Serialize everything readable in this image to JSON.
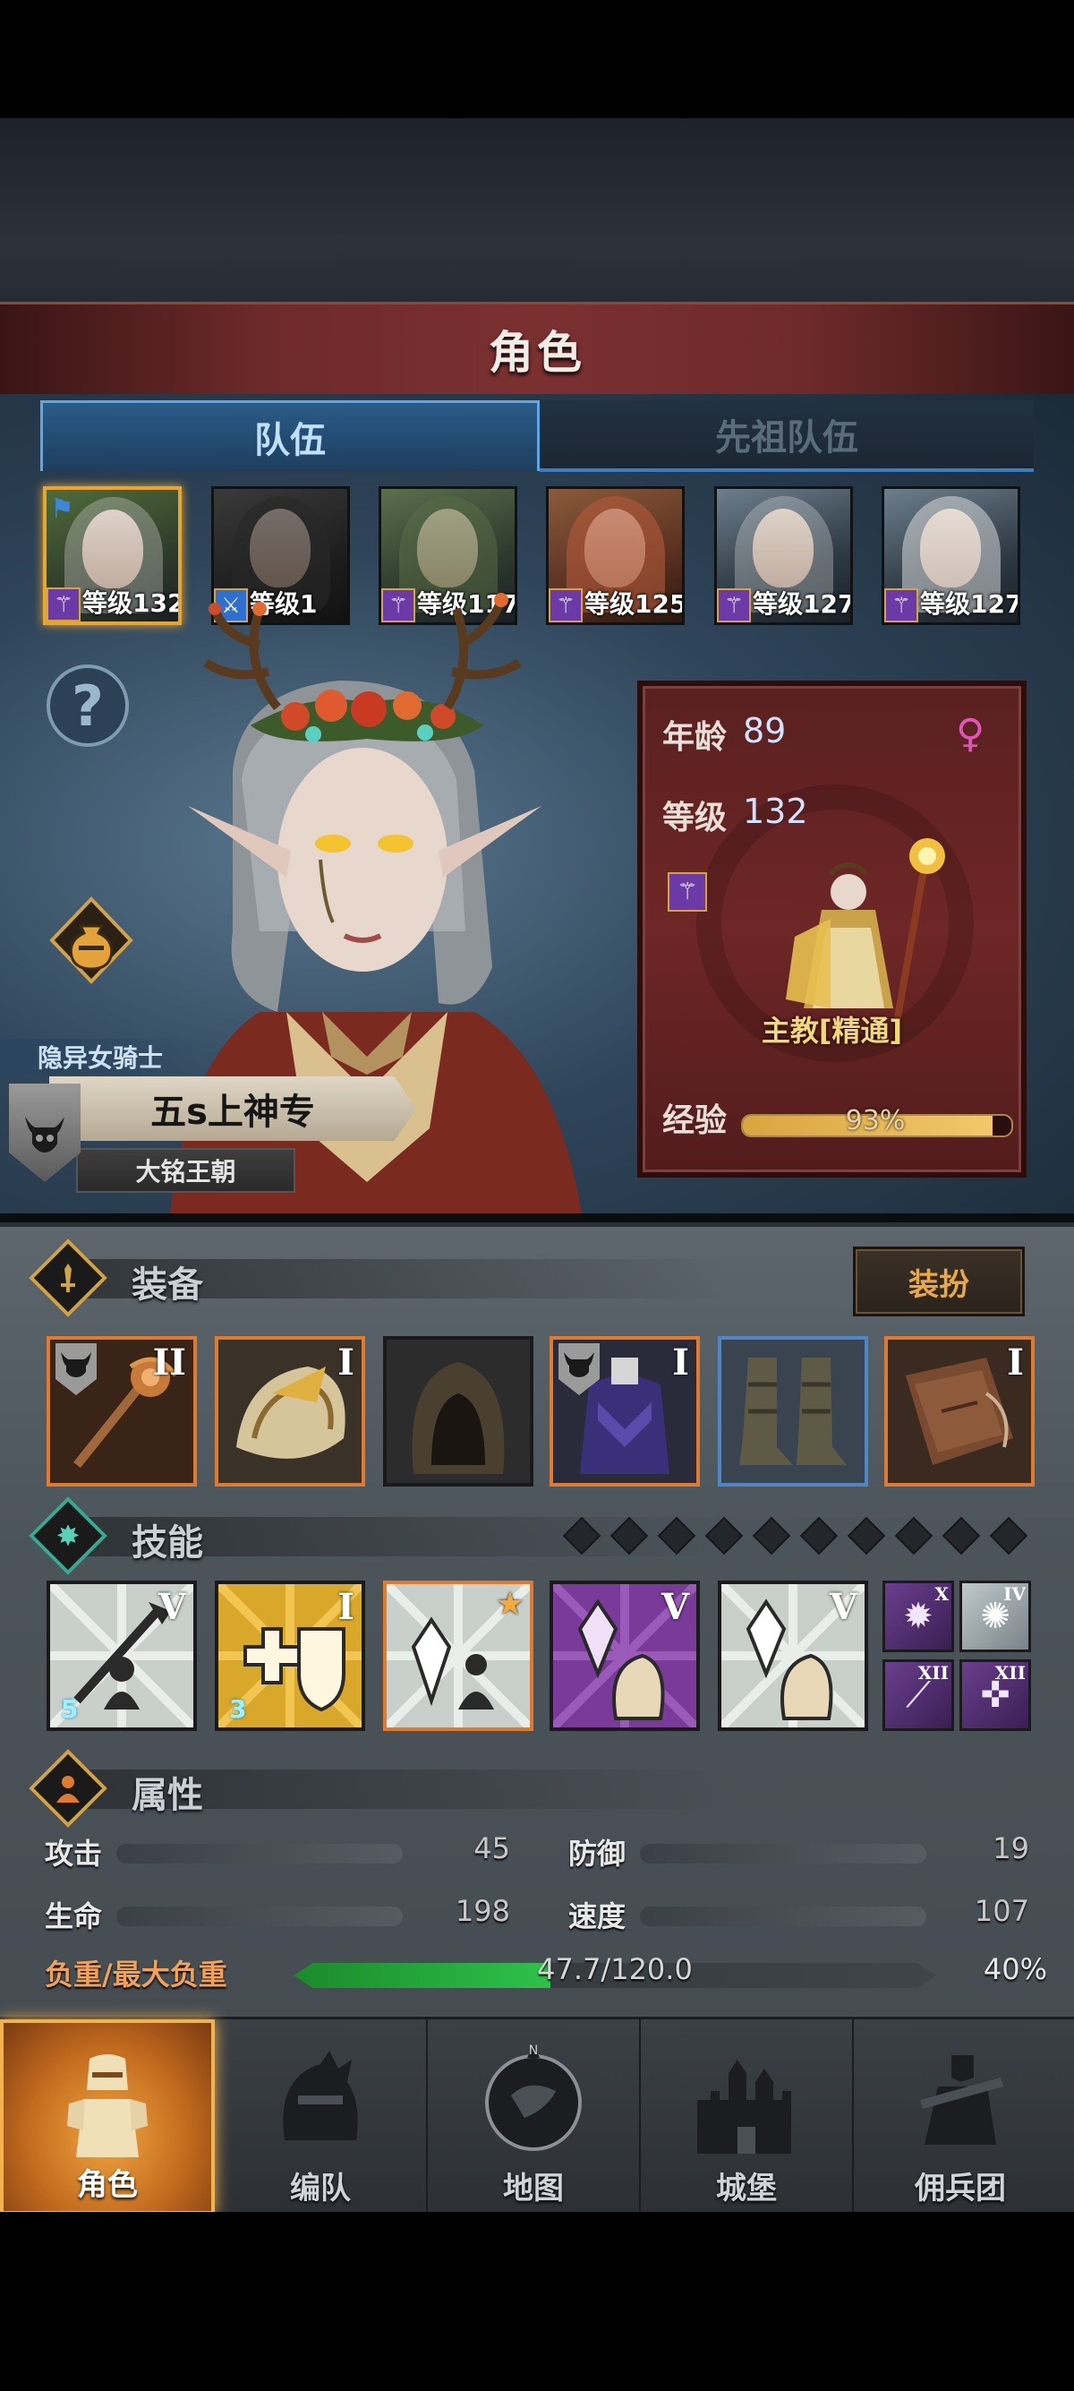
{
  "header": {
    "title": "角色"
  },
  "tabs": [
    {
      "label": "队伍",
      "active": true
    },
    {
      "label": "先祖队伍",
      "active": false
    }
  ],
  "party": [
    {
      "level_text": "等级132",
      "selected": true
    },
    {
      "level_text": "等级1",
      "selected": false
    },
    {
      "level_text": "等级117",
      "selected": false
    },
    {
      "level_text": "等级125",
      "selected": false
    },
    {
      "level_text": "等级127",
      "selected": false
    },
    {
      "level_text": "等级127",
      "selected": false
    }
  ],
  "character": {
    "class_title": "隐异女骑士",
    "name": "五s上神专",
    "dynasty": "大铭王朝"
  },
  "stat_card": {
    "age_label": "年龄",
    "age_value": "89",
    "level_label": "等级",
    "level_value": "132",
    "class_name": "主教[精通]",
    "exp_label": "经验",
    "exp_percent_text": "93%",
    "exp_fraction": 0.93,
    "gender_icon": "female-symbol"
  },
  "equipment": {
    "title": "装备",
    "outfit_label": "装扮",
    "slots": [
      {
        "name": "staff",
        "roman": "II",
        "rarity": "orange",
        "crest": true
      },
      {
        "name": "pauldron",
        "roman": "I",
        "rarity": "orange",
        "crest": false
      },
      {
        "name": "hood",
        "roman": "",
        "rarity": "none",
        "crest": false
      },
      {
        "name": "armor",
        "roman": "I",
        "rarity": "orange",
        "crest": true
      },
      {
        "name": "boots",
        "roman": "",
        "rarity": "blue",
        "crest": false
      },
      {
        "name": "book",
        "roman": "I",
        "rarity": "orange",
        "crest": false
      }
    ]
  },
  "skills": {
    "title": "技能",
    "dot_count": 10,
    "slots": [
      {
        "roman": "V",
        "count": "5",
        "star": false
      },
      {
        "roman": "I",
        "count": "3",
        "star": false
      },
      {
        "roman": "",
        "count": "",
        "star": true
      },
      {
        "roman": "V",
        "count": "",
        "star": false
      },
      {
        "roman": "V",
        "count": "",
        "star": false
      }
    ],
    "mini_slots": [
      {
        "roman": "X"
      },
      {
        "roman": "IV"
      },
      {
        "roman": "XII"
      },
      {
        "roman": "XII"
      }
    ]
  },
  "attributes": {
    "title": "属性",
    "items": [
      {
        "label": "攻击",
        "value": "45"
      },
      {
        "label": "防御",
        "value": "19"
      },
      {
        "label": "生命",
        "value": "198"
      },
      {
        "label": "速度",
        "value": "107"
      }
    ],
    "load_label": "负重/最大负重",
    "load_text": "47.7/120.0",
    "load_percent": "40%",
    "load_fraction": 0.4
  },
  "nav": [
    {
      "label": "角色",
      "active": true,
      "icon": "knight-icon"
    },
    {
      "label": "编队",
      "active": false,
      "icon": "helmet-icon"
    },
    {
      "label": "地图",
      "active": false,
      "icon": "compass-map-icon"
    },
    {
      "label": "城堡",
      "active": false,
      "icon": "castle-icon"
    },
    {
      "label": "佣兵团",
      "active": false,
      "icon": "mercenary-icon"
    }
  ],
  "colors": {
    "accent_gold": "#e8a530",
    "tab_blue": "#5fa6e6",
    "rarity_orange": "#e07a2e",
    "rarity_blue": "#4f86c6",
    "load_green": "#2ec24a"
  }
}
